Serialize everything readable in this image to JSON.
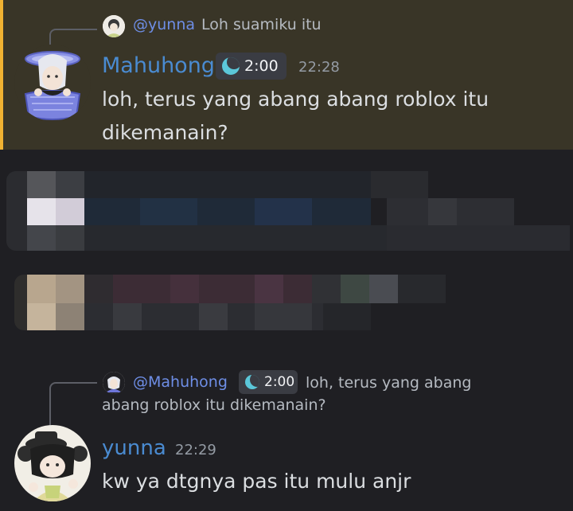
{
  "message1": {
    "reply": {
      "author": "@yunna",
      "text": "Loh suamiku itu"
    },
    "author": "Mahuhong",
    "author_color": "#4a8bd1",
    "badge_text": "2:00",
    "timestamp": "22:28",
    "content": "loh, terus yang abang abang roblox itu dikemanain?",
    "highlight_color": "#f0b232"
  },
  "message2": {
    "reply": {
      "author": "@Mahuhong",
      "badge_text": "2:00",
      "text": "loh, terus yang abang abang roblox itu dikemanain?"
    },
    "author": "yunna",
    "author_color": "#4a8bd1",
    "timestamp": "22:29",
    "content": "kw ya dtgnya pas itu mulu anjr"
  }
}
